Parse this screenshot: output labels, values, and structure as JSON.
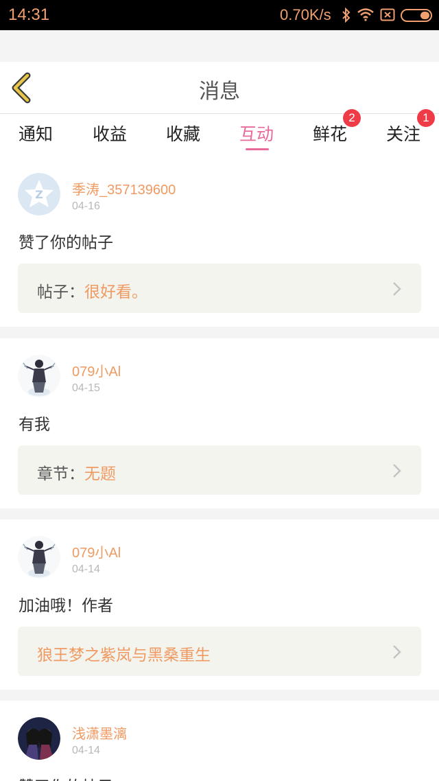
{
  "status_bar": {
    "time": "14:31",
    "net_speed": "0.70K/s",
    "icons": [
      "bluetooth-icon",
      "wifi-icon",
      "sim-icon",
      "battery-icon"
    ],
    "color": "#f0a070"
  },
  "header": {
    "title": "消息",
    "back_icon": "chevron-left-icon",
    "back_color": "#e8c64a"
  },
  "tabs": [
    {
      "label": "通知",
      "active": false,
      "badge": ""
    },
    {
      "label": "收益",
      "active": false,
      "badge": ""
    },
    {
      "label": "收藏",
      "active": false,
      "badge": ""
    },
    {
      "label": "互动",
      "active": true,
      "badge": ""
    },
    {
      "label": "鲜花",
      "active": false,
      "badge": "2"
    },
    {
      "label": "关注",
      "active": false,
      "badge": "1"
    }
  ],
  "accent_color": "#e86a9a",
  "messages": [
    {
      "username": "季涛_357139600",
      "date": "04-16",
      "action": "赞了你的帖子",
      "ref_label": "帖子：",
      "ref_title": "很好看。",
      "avatar": "default-star-avatar"
    },
    {
      "username": "079小Al",
      "date": "04-15",
      "action": "有我",
      "ref_label": "章节：",
      "ref_title": "无题",
      "avatar": "anime-figure-avatar"
    },
    {
      "username": "079小Al",
      "date": "04-14",
      "action": "加油哦！作者",
      "ref_label": "",
      "ref_title": "狼王梦之紫岚与黑桑重生",
      "avatar": "anime-figure-avatar"
    },
    {
      "username": "浅潇墨漓",
      "date": "04-14",
      "action": "赞了你的帖子",
      "ref_label": "",
      "ref_title": "",
      "avatar": "anime-couple-avatar"
    }
  ]
}
